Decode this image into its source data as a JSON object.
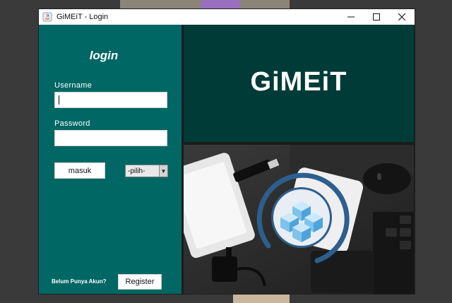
{
  "window": {
    "title": "GiMEiT - Login",
    "controls": [
      "minimize-icon",
      "maximize-icon",
      "close-icon"
    ]
  },
  "login": {
    "heading": "login",
    "username_label": "Username",
    "username_value": "",
    "password_label": "Password",
    "password_value": "",
    "submit_label": "masuk",
    "role_select_value": "-pilih-",
    "no_account_text": "Belum Punya Akun?",
    "register_label": "Register"
  },
  "brand": {
    "name": "GiMEiT",
    "logo_icon": "cubes-logo-icon",
    "colors": {
      "panel": "#016764",
      "brand_bg": "#003b38",
      "logo_ring": "#2c5f8e"
    }
  }
}
